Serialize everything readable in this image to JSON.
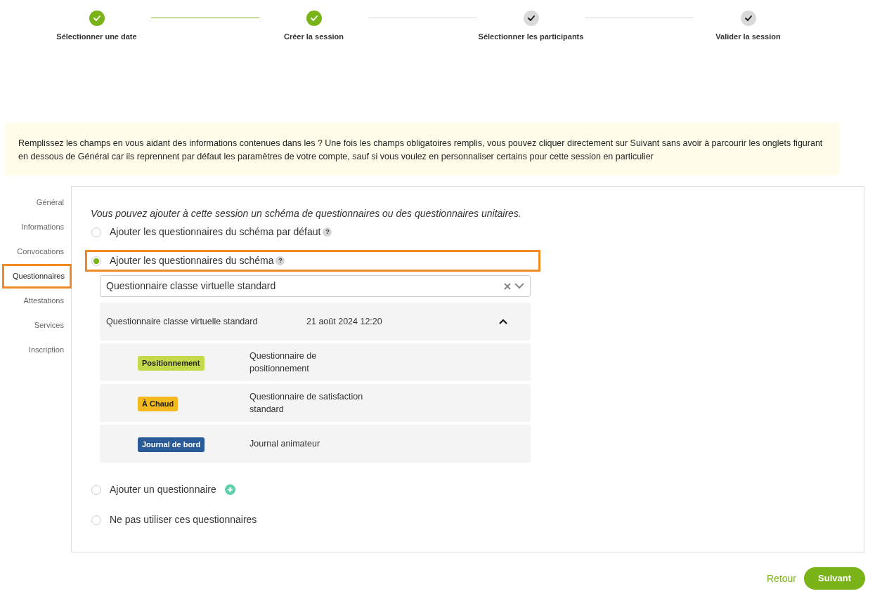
{
  "steps": [
    {
      "label": "Sélectionner une date",
      "done": true
    },
    {
      "label": "Créer la session",
      "done": true
    },
    {
      "label": "Sélectionner les participants",
      "done": false
    },
    {
      "label": "Valider la session",
      "done": false
    }
  ],
  "info_text": "Remplissez les champs en vous aidant des informations contenues dans les ? Une fois les champs obligatoires remplis, vous pouvez cliquer directement sur Suivant sans avoir à parcourir les onglets figurant en dessous de Général car ils reprennent par défaut les paramètres de votre compte, sauf si vous voulez en personnaliser certains pour cette session en particulier",
  "sidebar": {
    "items": [
      {
        "label": "Général",
        "selected": false,
        "highlighted": false
      },
      {
        "label": "Informations",
        "selected": false,
        "highlighted": false
      },
      {
        "label": "Convocations",
        "selected": false,
        "highlighted": false
      },
      {
        "label": "Questionnaires",
        "selected": true,
        "highlighted": true
      },
      {
        "label": "Attestations",
        "selected": false,
        "highlighted": false
      },
      {
        "label": "Services",
        "selected": false,
        "highlighted": false
      },
      {
        "label": "Inscription",
        "selected": false,
        "highlighted": false
      }
    ]
  },
  "intro": "Vous pouvez ajouter à cette session un schéma de questionnaires ou des questionnaires unitaires.",
  "options": [
    {
      "label": "Ajouter les questionnaires du schéma par défaut",
      "selected": false,
      "highlighted": false,
      "help": "?",
      "add": false
    },
    {
      "label": "Ajouter les questionnaires du schéma",
      "selected": true,
      "highlighted": true,
      "help": "?",
      "add": false,
      "schema": {
        "value": "Questionnaire classe virtuelle standard",
        "accordion": {
          "name": "Questionnaire classe virtuelle standard",
          "date": "21 août 2024 12:20",
          "expanded": true,
          "rows": [
            {
              "tag": "Positionnement",
              "color": "#c5d94a",
              "name": "Questionnaire de positionnement"
            },
            {
              "tag": "À Chaud",
              "color": "#f4b91e",
              "name": "Questionnaire de satisfaction standard"
            },
            {
              "tag": "Journal de bord",
              "color": "#2a5a98",
              "name": "Journal animateur"
            }
          ]
        }
      }
    },
    {
      "label": "Ajouter un questionnaire",
      "selected": false,
      "highlighted": false,
      "add": true
    },
    {
      "label": "Ne pas utiliser ces questionnaires",
      "selected": false,
      "highlighted": false,
      "add": false
    }
  ],
  "footer": {
    "back": "Retour",
    "next": "Suivant"
  }
}
